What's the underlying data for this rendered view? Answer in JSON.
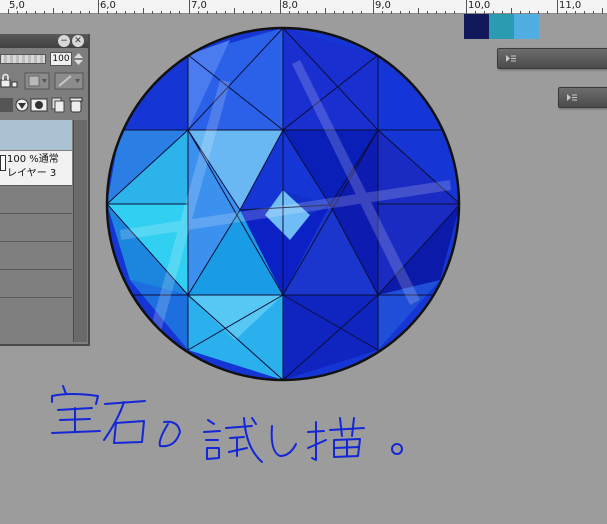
{
  "ruler": {
    "labels": [
      "5,0",
      "6,0",
      "7,0",
      "8,0",
      "9,0",
      "10,0",
      "11,0"
    ]
  },
  "color_swatches": [
    "#12195a",
    "#2a9bb0",
    "#51aee2"
  ],
  "layer_panel": {
    "opacity_value": "100",
    "selected_layer": {
      "opacity_blend": "100 %通常",
      "name": "レイヤー 3"
    }
  },
  "colors": {
    "canvas_background": "#9c9c9c",
    "ink": "#1327d6",
    "gem_outline": "#111111"
  }
}
